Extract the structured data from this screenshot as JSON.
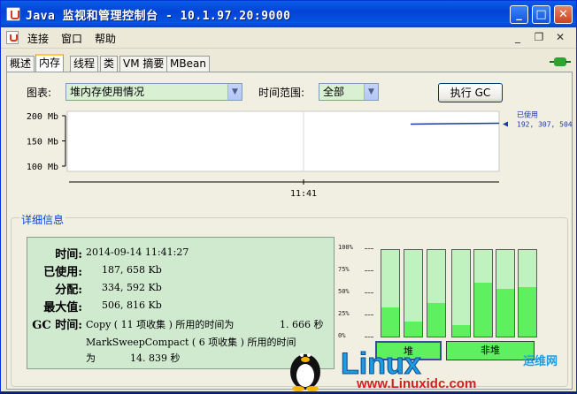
{
  "window": {
    "title": "Java 监视和管理控制台 - 10.1.97.20:9000"
  },
  "menu": {
    "items": [
      "连接",
      "窗口",
      "帮助"
    ]
  },
  "tabs": [
    "概述",
    "内存",
    "线程",
    "类",
    "VM 摘要",
    "MBean"
  ],
  "active_tab": "内存",
  "controls": {
    "chart_label": "图表:",
    "chart_value": "堆内存使用情况",
    "time_label": "时间范围:",
    "time_value": "全部",
    "gc_button": "执行 GC"
  },
  "chart_data": {
    "type": "line",
    "y_ticks": [
      "200 Mb",
      "150 Mb",
      "100 Mb"
    ],
    "ylim_mb": [
      100,
      200
    ],
    "x_ticks": [
      "11:41"
    ],
    "series": [
      {
        "name": "已使用",
        "values_bytes": [
          192307504
        ],
        "label": "192, 307, 504"
      }
    ]
  },
  "details": {
    "title": "详细信息",
    "rows": [
      {
        "key": "时间:",
        "value": "2014-09-14 11:41:27"
      },
      {
        "key": "已使用:",
        "value": "187, 658 Kb"
      },
      {
        "key": "分配:",
        "value": "334, 592 Kb"
      },
      {
        "key": "最大值:",
        "value": "506, 816 Kb"
      }
    ],
    "gc_key": "GC 时间:",
    "gc_line1": "Copy ( 11 项收集 ) 所用的时间为",
    "gc_line1_time": "1. 666  秒",
    "gc_line2": "MarkSweepCompact ( 6 项收集 ) 所用的时间",
    "gc_line3_prefix": "为",
    "gc_line3_time": "14. 839  秒"
  },
  "pools": {
    "pct_labels": [
      "100%",
      "75%",
      "50%",
      "25%",
      "0%"
    ],
    "heap_label": "堆",
    "nonheap_label": "非堆",
    "heap_fill": [
      0.34,
      0.17,
      0.39
    ],
    "nonheap_fill": [
      0.13,
      0.62,
      0.55,
      0.57
    ]
  },
  "watermark": {
    "brand": "Linux",
    "url": "www.Linuxidc.com",
    "site": "运维网"
  },
  "colors": {
    "titlebar": "#0554e3",
    "panel_green": "#d0ead0",
    "bar_fill": "#5ef05e",
    "bar_bg": "#c0f2bf"
  }
}
